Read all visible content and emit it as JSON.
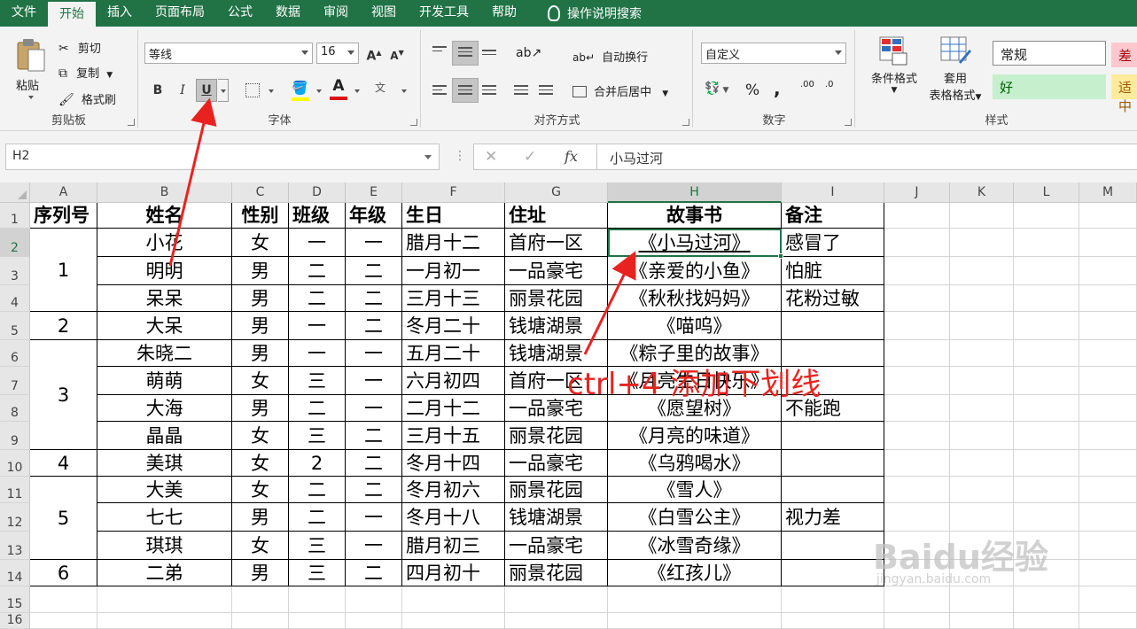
{
  "menu": {
    "tabs": [
      "文件",
      "开始",
      "插入",
      "页面布局",
      "公式",
      "数据",
      "审阅",
      "视图",
      "开发工具",
      "帮助"
    ],
    "active": 1,
    "search": "操作说明搜索"
  },
  "ribbon": {
    "clipboard": {
      "paste": "粘贴",
      "cut": "剪切",
      "copy": "复制",
      "format_painter": "格式刷",
      "label": "剪贴板"
    },
    "font": {
      "name": "等线",
      "size": "16",
      "bold": "B",
      "italic": "I",
      "underline": "U",
      "wen": "文",
      "label": "字体",
      "grow": "A",
      "shrink": "A"
    },
    "alignment": {
      "wrap": "自动换行",
      "merge": "合并后居中",
      "label": "对齐方式"
    },
    "number": {
      "format": "自定义",
      "percent": "%",
      "comma": ",",
      "label": "数字",
      "inc": ".00",
      "dec": ".0"
    },
    "styles": {
      "conditional": "条件格式",
      "table_format_1": "套用",
      "table_format_2": "表格格式",
      "normal": "常规",
      "bad": "差",
      "good": "好",
      "neutral": "适中",
      "label": "样式"
    }
  },
  "formula_bar": {
    "name_box": "H2",
    "fx": "fx",
    "value": "小马过河"
  },
  "columns": [
    "A",
    "B",
    "C",
    "D",
    "E",
    "F",
    "G",
    "H",
    "I",
    "J",
    "K",
    "L",
    "M"
  ],
  "rows": [
    "1",
    "2",
    "3",
    "4",
    "5",
    "6",
    "7",
    "8",
    "9",
    "10",
    "11",
    "12",
    "13",
    "14",
    "15",
    "16"
  ],
  "headers": [
    "序列号",
    "姓名",
    "性别",
    "班级",
    "年级",
    "生日",
    "住址",
    "故事书",
    "备注"
  ],
  "groups": [
    "1",
    "2",
    "3",
    "4",
    "5",
    "6"
  ],
  "table": [
    [
      "小花",
      "女",
      "一",
      "一",
      "腊月十二",
      "首府一区",
      "《小马过河》",
      "感冒了"
    ],
    [
      "明明",
      "男",
      "二",
      "二",
      "一月初一",
      "一品豪宅",
      "《亲爱的小鱼》",
      "怕脏"
    ],
    [
      "呆呆",
      "男",
      "二",
      "二",
      "三月十三",
      "丽景花园",
      "《秋秋找妈妈》",
      "花粉过敏"
    ],
    [
      "大呆",
      "男",
      "一",
      "二",
      "冬月二十",
      "钱塘湖景",
      "《喵呜》",
      ""
    ],
    [
      "朱晓二",
      "男",
      "一",
      "一",
      "五月二十",
      "钱塘湖景",
      "《粽子里的故事》",
      ""
    ],
    [
      "萌萌",
      "女",
      "三",
      "一",
      "六月初四",
      "首府一区",
      "《月亮生日快乐》",
      ""
    ],
    [
      "大海",
      "男",
      "二",
      "一",
      "二月十二",
      "一品豪宅",
      "《愿望树》",
      "不能跑"
    ],
    [
      "晶晶",
      "女",
      "三",
      "二",
      "三月十五",
      "丽景花园",
      "《月亮的味道》",
      ""
    ],
    [
      "美琪",
      "女",
      "2",
      "二",
      "冬月十四",
      "一品豪宅",
      "《乌鸦喝水》",
      ""
    ],
    [
      "大美",
      "女",
      "二",
      "二",
      "冬月初六",
      "丽景花园",
      "《雪人》",
      ""
    ],
    [
      "七七",
      "男",
      "二",
      "一",
      "冬月十八",
      "钱塘湖景",
      "《白雪公主》",
      "视力差"
    ],
    [
      "琪琪",
      "女",
      "三",
      "一",
      "腊月初三",
      "一品豪宅",
      "《冰雪奇缘》",
      ""
    ],
    [
      "二弟",
      "男",
      "三",
      "二",
      "四月初十",
      "丽景花园",
      "《红孩儿》",
      ""
    ]
  ],
  "annotation": "ctrl+4 添加下划线",
  "watermark": {
    "brand": "Baidu经验",
    "url": "jingyan.baidu.com"
  }
}
